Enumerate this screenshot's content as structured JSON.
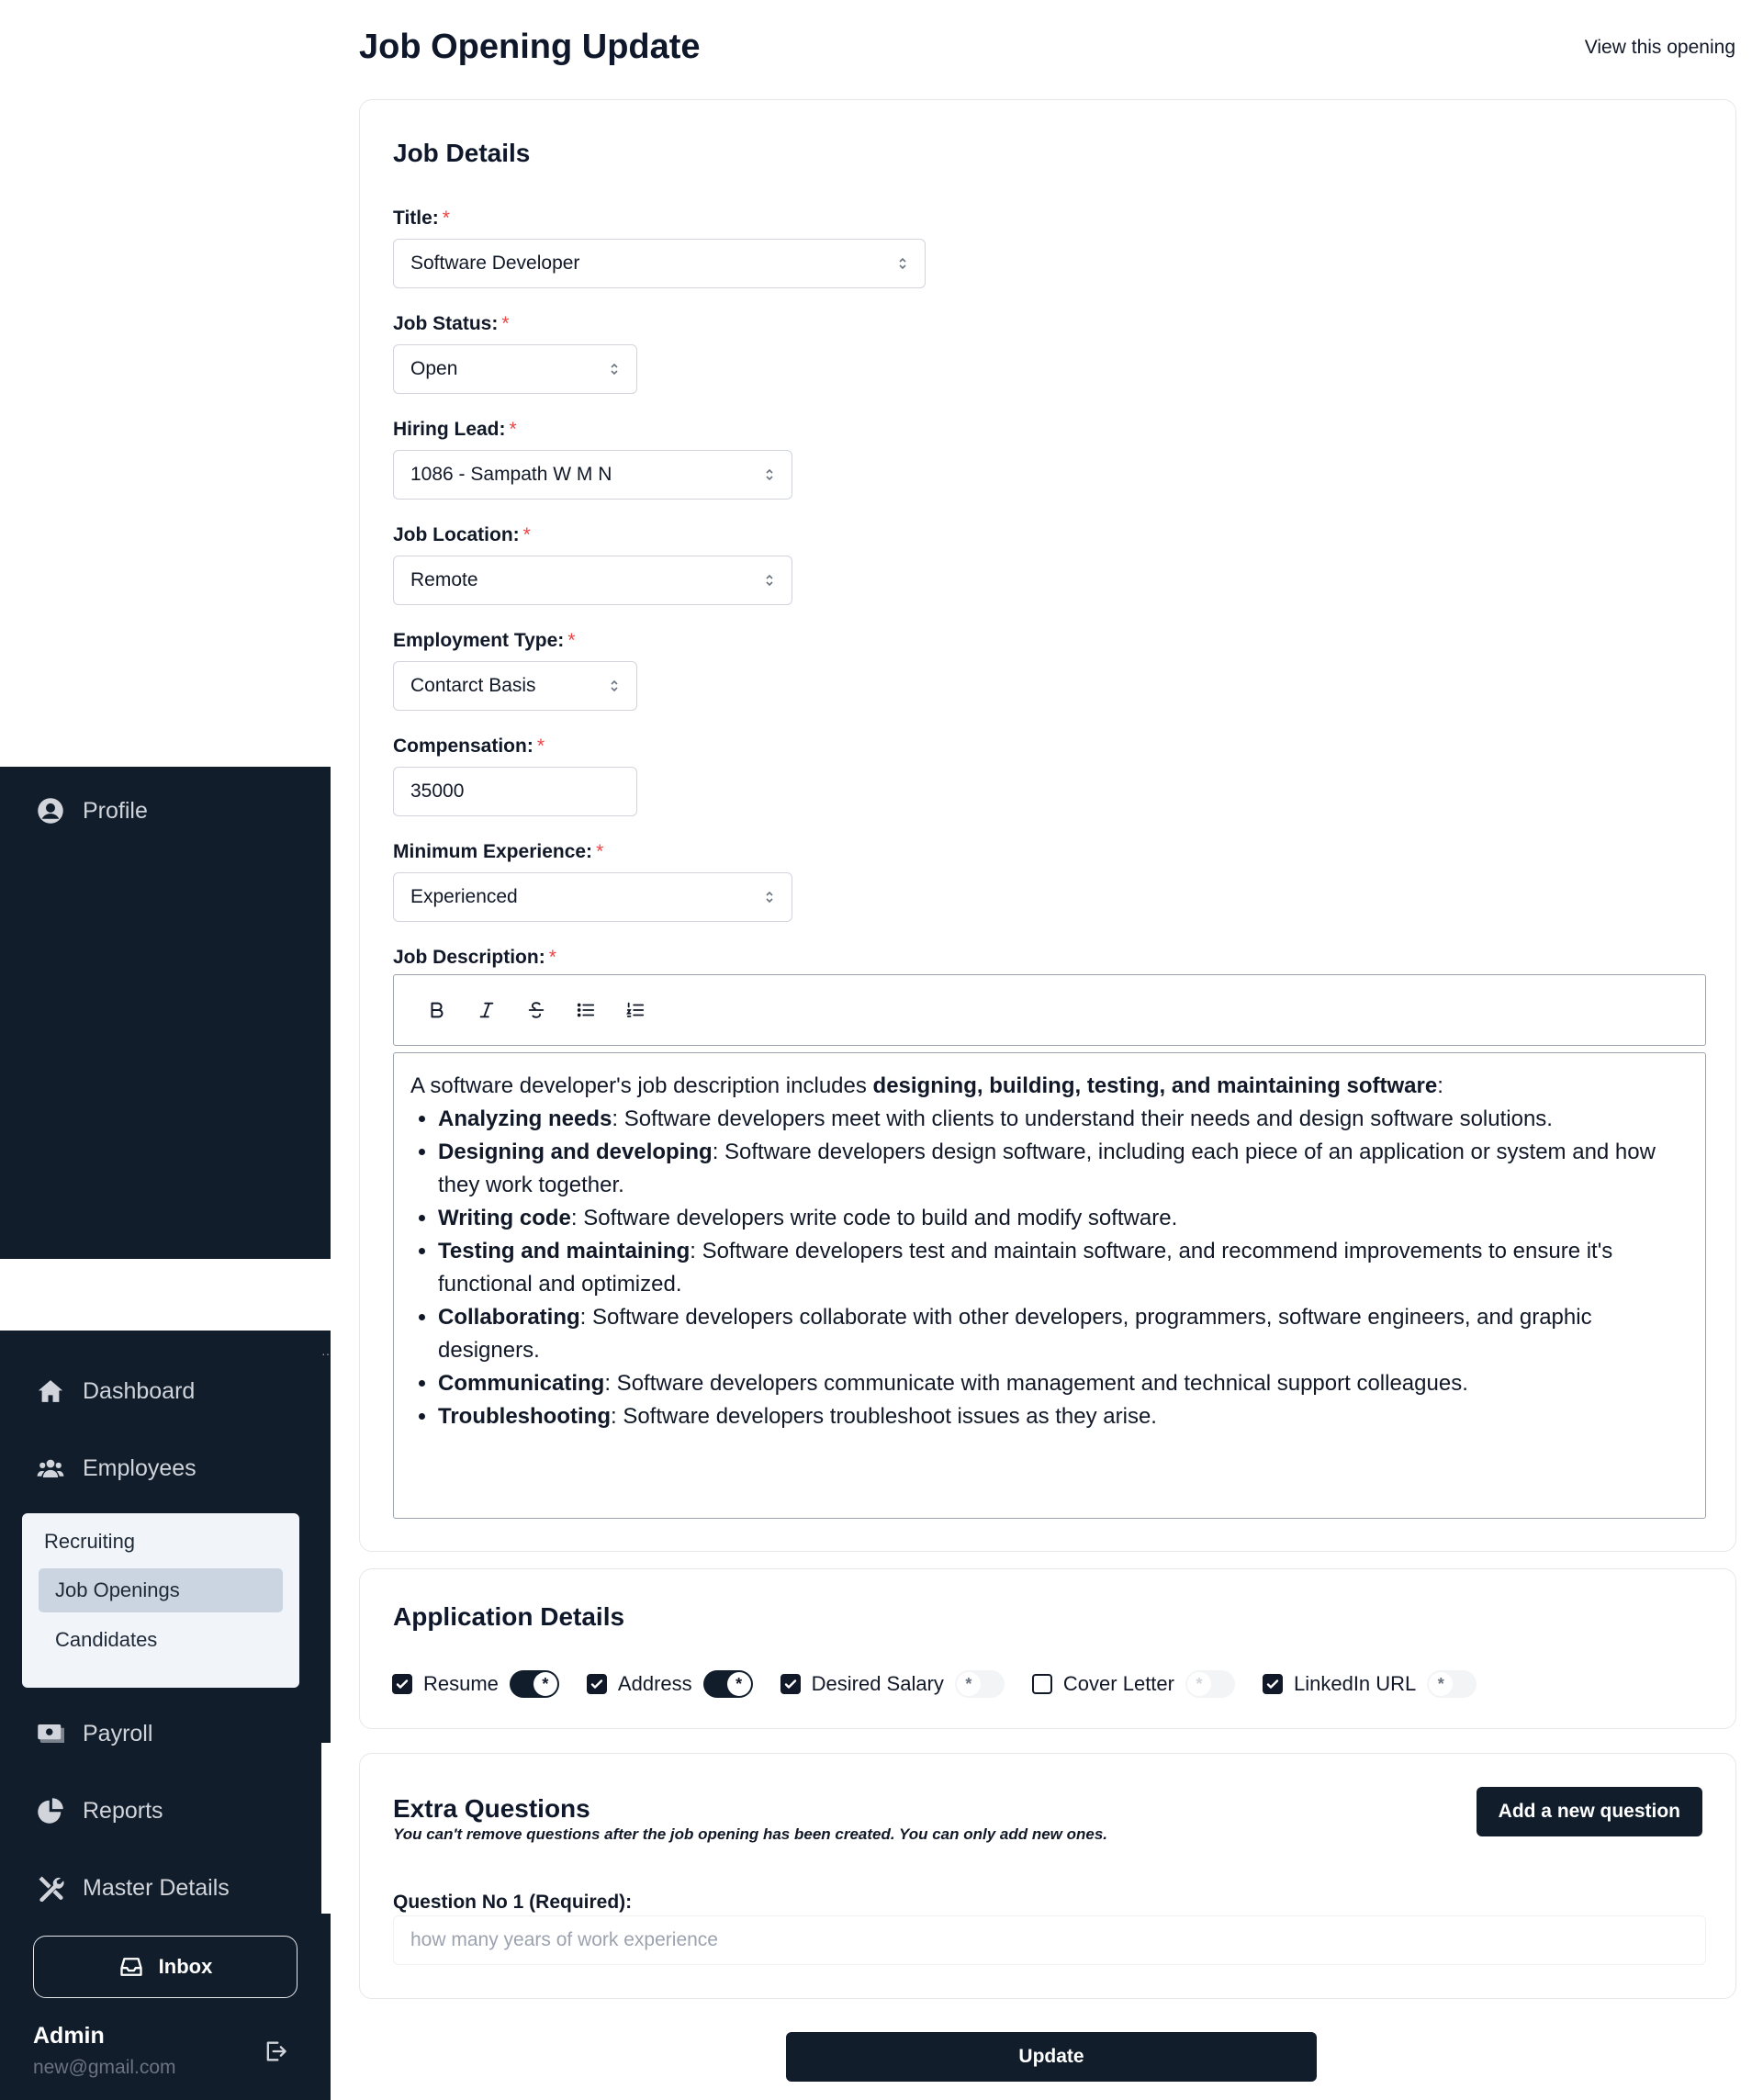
{
  "page": {
    "title": "Job Opening Update",
    "view_link": "View this opening"
  },
  "sidebar": {
    "profile_label": "Profile",
    "items": [
      {
        "label": "Dashboard",
        "icon": "home-icon"
      },
      {
        "label": "Employees",
        "icon": "users-icon"
      },
      {
        "label": "Payroll",
        "icon": "money-icon"
      },
      {
        "label": "Reports",
        "icon": "pie-chart-icon"
      },
      {
        "label": "Master Details",
        "icon": "tools-icon"
      }
    ],
    "recruiting": {
      "title": "Recruiting",
      "items": [
        {
          "label": "Job Openings",
          "active": true
        },
        {
          "label": "Candidates",
          "active": false
        }
      ]
    },
    "inbox_label": "Inbox",
    "user": {
      "name": "Admin",
      "email": "new@gmail.com"
    }
  },
  "job_details": {
    "heading": "Job Details",
    "title_label": "Title:",
    "title_value": "Software Developer",
    "status_label": "Job Status:",
    "status_value": "Open",
    "lead_label": "Hiring Lead:",
    "lead_value": "1086 - Sampath W M N",
    "location_label": "Job Location:",
    "location_value": "Remote",
    "employment_label": "Employment Type:",
    "employment_value": "Contarct Basis",
    "compensation_label": "Compensation:",
    "compensation_value": "35000",
    "experience_label": "Minimum Experience:",
    "experience_value": "Experienced",
    "description_label": "Job Description:",
    "required_mark": "*",
    "toolbar": [
      "bold-icon",
      "italic-icon",
      "strikethrough-icon",
      "bullet-list-icon",
      "ordered-list-icon"
    ],
    "description": {
      "intro_pre": "A software developer's job description includes ",
      "intro_bold": "designing, building, testing, and maintaining software",
      "intro_post": ":",
      "bullets": [
        {
          "bold": "Analyzing needs",
          "text": ": Software developers meet with clients to understand their needs and design software solutions."
        },
        {
          "bold": "Designing and developing",
          "text": ": Software developers design software, including each piece of an application or system and how they work together."
        },
        {
          "bold": "Writing code",
          "text": ": Software developers write code to build and modify software."
        },
        {
          "bold": "Testing and maintaining",
          "text": ": Software developers test and maintain software, and recommend improvements to ensure it's functional and optimized."
        },
        {
          "bold": "Collaborating",
          "text": ": Software developers collaborate with other developers, programmers, software engineers, and graphic designers."
        },
        {
          "bold": "Communicating",
          "text": ": Software developers communicate with management and technical support colleagues."
        },
        {
          "bold": "Troubleshooting",
          "text": ": Software developers troubleshoot issues as they arise."
        }
      ]
    }
  },
  "application_details": {
    "heading": "Application Details",
    "items": [
      {
        "label": "Resume",
        "checked": true,
        "required": true
      },
      {
        "label": "Address",
        "checked": true,
        "required": true
      },
      {
        "label": "Desired Salary",
        "checked": true,
        "required": false
      },
      {
        "label": "Cover Letter",
        "checked": false,
        "required": false
      },
      {
        "label": "LinkedIn URL",
        "checked": true,
        "required": false
      }
    ],
    "toggle_symbol": "*"
  },
  "extra_questions": {
    "heading": "Extra Questions",
    "note": "You can't remove questions after the job opening has been created. You can only add new ones.",
    "add_button": "Add a new question",
    "question_label": "Question No 1 (Required):",
    "question_placeholder": "how many years of work experience"
  },
  "update_button": "Update",
  "colors": {
    "sidebar_bg": "#111d2b",
    "primary": "#111d2b",
    "required": "#ef4444"
  }
}
